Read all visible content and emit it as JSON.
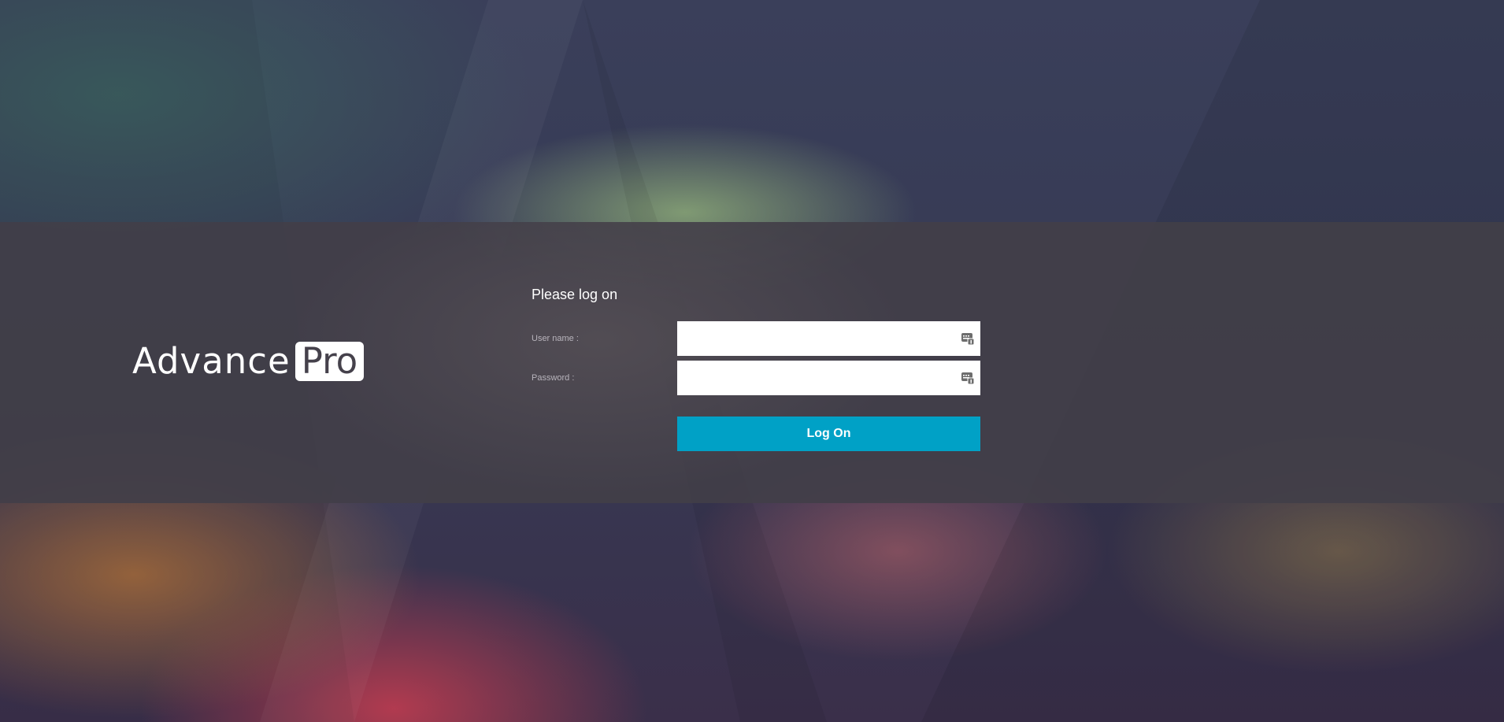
{
  "logo": {
    "word": "Advance",
    "boxed": "Pro"
  },
  "login": {
    "prompt": "Please log on",
    "username_label": "User name :",
    "username_value": "",
    "password_label": "Password :",
    "password_value": "",
    "logon_button": "Log On",
    "keyboard_icon": "virtual-keyboard-icon"
  },
  "colors": {
    "band": "#423e48",
    "button": "#00a1c6",
    "field": "#ffffff"
  }
}
